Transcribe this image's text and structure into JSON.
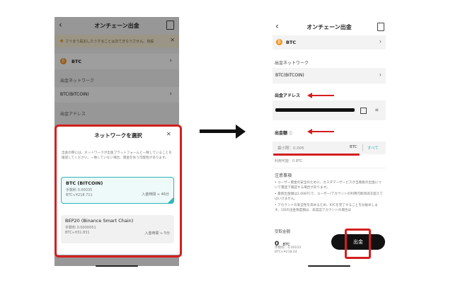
{
  "left": {
    "header_title": "オンチェーン出金",
    "notice": "さうまう是おしたうすることは次てきなうさせん。自殺",
    "coin": "BTC",
    "network_label": "出金ネットワーク",
    "network_value": "BTC(BITCOIN)",
    "address_label": "出金アドレス",
    "modal": {
      "title": "ネットワークを選択",
      "description": "出金の際には、ネットワークが出金プラットフォームと一致していることを確認してください。一致していない場合、資金を失う可能性があります。",
      "options": [
        {
          "name": "BTC (BITCOIN)",
          "fee": "手数料 0.00035",
          "fee_value": "BTC≈¥218.711",
          "time": "入金時間 ≈ 46分",
          "selected": true
        },
        {
          "name": "BEP20 (Binance Smart Chain)",
          "fee": "手数料 0.0000051",
          "fee_value": "BTC≈¥31.831",
          "time": "入金時間 ≈ 5分",
          "selected": false
        }
      ]
    }
  },
  "right": {
    "header_title": "オンチェーン出金",
    "coin": "BTC",
    "network_label": "出金ネットワーク",
    "network_value": "BTC(BITCOIN)",
    "address_label": "出金アドレス",
    "amount_label": "出金額",
    "amount_placeholder": "最小限：0.005",
    "amount_unit": "BTC",
    "all_label": "すべて",
    "available": "利用可能：0 BTC",
    "notes_title": "注意事項",
    "notes": [
      "ユーザー資金の安全のために、カスタマーサービスが当看板の出金について電話で確認する場合があります。",
      "最新出金額は2.00BTCで、ユーザー/アカウントの利用可能残高を超えてはいけません。",
      "アカウントの安全性を高めるため、KYCを完了することをお勧めします。1日の出金限度額は、未認証アカウントの場合は"
    ],
    "receive_label": "受取金額",
    "receive_amount": "0",
    "receive_unit": "BTC",
    "fee_line": "手数料：0.00035",
    "fee_value": "BTC≈¥218.44",
    "submit_label": "出金"
  },
  "colors": {
    "highlight_red": "#d41f1f",
    "accent_teal": "#2fb5b8",
    "btc_orange": "#f7931a"
  }
}
